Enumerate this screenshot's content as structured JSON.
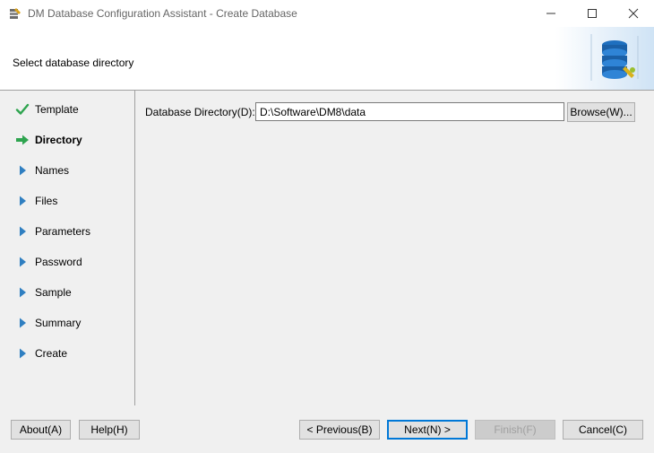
{
  "window": {
    "title": "DM Database Configuration Assistant - Create Database",
    "icon": "app-database-icon"
  },
  "header": {
    "subtitle": "Select database directory",
    "graphic": "database-stack-icon"
  },
  "steps": [
    {
      "label": "Template",
      "state": "done",
      "icon": "check-icon"
    },
    {
      "label": "Directory",
      "state": "current",
      "icon": "arrow-right-icon"
    },
    {
      "label": "Names",
      "state": "pending",
      "icon": "triangle-right-icon"
    },
    {
      "label": "Files",
      "state": "pending",
      "icon": "triangle-right-icon"
    },
    {
      "label": "Parameters",
      "state": "pending",
      "icon": "triangle-right-icon"
    },
    {
      "label": "Password",
      "state": "pending",
      "icon": "triangle-right-icon"
    },
    {
      "label": "Sample",
      "state": "pending",
      "icon": "triangle-right-icon"
    },
    {
      "label": "Summary",
      "state": "pending",
      "icon": "triangle-right-icon"
    },
    {
      "label": "Create",
      "state": "pending",
      "icon": "triangle-right-icon"
    }
  ],
  "main": {
    "dir_label": "Database Directory(D):",
    "dir_value": "D:\\Software\\DM8\\data",
    "browse_label": "Browse(W)..."
  },
  "footer": {
    "about_label": "About(A)",
    "help_label": "Help(H)",
    "previous_label": "< Previous(B)",
    "next_label": "Next(N) >",
    "finish_label": "Finish(F)",
    "cancel_label": "Cancel(C)"
  },
  "colors": {
    "check": "#2ea44f",
    "arrow": "#2ea44f",
    "pending": "#2f7fc1",
    "default_button_border": "#0078d7"
  }
}
